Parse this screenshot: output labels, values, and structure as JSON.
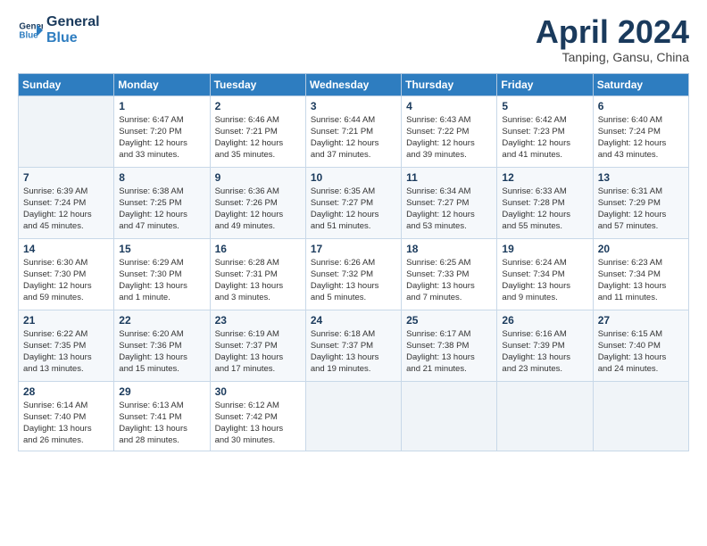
{
  "logo": {
    "line1": "General",
    "line2": "Blue"
  },
  "title": "April 2024",
  "subtitle": "Tanping, Gansu, China",
  "days_header": [
    "Sunday",
    "Monday",
    "Tuesday",
    "Wednesday",
    "Thursday",
    "Friday",
    "Saturday"
  ],
  "weeks": [
    [
      {
        "num": "",
        "info": ""
      },
      {
        "num": "1",
        "info": "Sunrise: 6:47 AM\nSunset: 7:20 PM\nDaylight: 12 hours\nand 33 minutes."
      },
      {
        "num": "2",
        "info": "Sunrise: 6:46 AM\nSunset: 7:21 PM\nDaylight: 12 hours\nand 35 minutes."
      },
      {
        "num": "3",
        "info": "Sunrise: 6:44 AM\nSunset: 7:21 PM\nDaylight: 12 hours\nand 37 minutes."
      },
      {
        "num": "4",
        "info": "Sunrise: 6:43 AM\nSunset: 7:22 PM\nDaylight: 12 hours\nand 39 minutes."
      },
      {
        "num": "5",
        "info": "Sunrise: 6:42 AM\nSunset: 7:23 PM\nDaylight: 12 hours\nand 41 minutes."
      },
      {
        "num": "6",
        "info": "Sunrise: 6:40 AM\nSunset: 7:24 PM\nDaylight: 12 hours\nand 43 minutes."
      }
    ],
    [
      {
        "num": "7",
        "info": "Sunrise: 6:39 AM\nSunset: 7:24 PM\nDaylight: 12 hours\nand 45 minutes."
      },
      {
        "num": "8",
        "info": "Sunrise: 6:38 AM\nSunset: 7:25 PM\nDaylight: 12 hours\nand 47 minutes."
      },
      {
        "num": "9",
        "info": "Sunrise: 6:36 AM\nSunset: 7:26 PM\nDaylight: 12 hours\nand 49 minutes."
      },
      {
        "num": "10",
        "info": "Sunrise: 6:35 AM\nSunset: 7:27 PM\nDaylight: 12 hours\nand 51 minutes."
      },
      {
        "num": "11",
        "info": "Sunrise: 6:34 AM\nSunset: 7:27 PM\nDaylight: 12 hours\nand 53 minutes."
      },
      {
        "num": "12",
        "info": "Sunrise: 6:33 AM\nSunset: 7:28 PM\nDaylight: 12 hours\nand 55 minutes."
      },
      {
        "num": "13",
        "info": "Sunrise: 6:31 AM\nSunset: 7:29 PM\nDaylight: 12 hours\nand 57 minutes."
      }
    ],
    [
      {
        "num": "14",
        "info": "Sunrise: 6:30 AM\nSunset: 7:30 PM\nDaylight: 12 hours\nand 59 minutes."
      },
      {
        "num": "15",
        "info": "Sunrise: 6:29 AM\nSunset: 7:30 PM\nDaylight: 13 hours\nand 1 minute."
      },
      {
        "num": "16",
        "info": "Sunrise: 6:28 AM\nSunset: 7:31 PM\nDaylight: 13 hours\nand 3 minutes."
      },
      {
        "num": "17",
        "info": "Sunrise: 6:26 AM\nSunset: 7:32 PM\nDaylight: 13 hours\nand 5 minutes."
      },
      {
        "num": "18",
        "info": "Sunrise: 6:25 AM\nSunset: 7:33 PM\nDaylight: 13 hours\nand 7 minutes."
      },
      {
        "num": "19",
        "info": "Sunrise: 6:24 AM\nSunset: 7:34 PM\nDaylight: 13 hours\nand 9 minutes."
      },
      {
        "num": "20",
        "info": "Sunrise: 6:23 AM\nSunset: 7:34 PM\nDaylight: 13 hours\nand 11 minutes."
      }
    ],
    [
      {
        "num": "21",
        "info": "Sunrise: 6:22 AM\nSunset: 7:35 PM\nDaylight: 13 hours\nand 13 minutes."
      },
      {
        "num": "22",
        "info": "Sunrise: 6:20 AM\nSunset: 7:36 PM\nDaylight: 13 hours\nand 15 minutes."
      },
      {
        "num": "23",
        "info": "Sunrise: 6:19 AM\nSunset: 7:37 PM\nDaylight: 13 hours\nand 17 minutes."
      },
      {
        "num": "24",
        "info": "Sunrise: 6:18 AM\nSunset: 7:37 PM\nDaylight: 13 hours\nand 19 minutes."
      },
      {
        "num": "25",
        "info": "Sunrise: 6:17 AM\nSunset: 7:38 PM\nDaylight: 13 hours\nand 21 minutes."
      },
      {
        "num": "26",
        "info": "Sunrise: 6:16 AM\nSunset: 7:39 PM\nDaylight: 13 hours\nand 23 minutes."
      },
      {
        "num": "27",
        "info": "Sunrise: 6:15 AM\nSunset: 7:40 PM\nDaylight: 13 hours\nand 24 minutes."
      }
    ],
    [
      {
        "num": "28",
        "info": "Sunrise: 6:14 AM\nSunset: 7:40 PM\nDaylight: 13 hours\nand 26 minutes."
      },
      {
        "num": "29",
        "info": "Sunrise: 6:13 AM\nSunset: 7:41 PM\nDaylight: 13 hours\nand 28 minutes."
      },
      {
        "num": "30",
        "info": "Sunrise: 6:12 AM\nSunset: 7:42 PM\nDaylight: 13 hours\nand 30 minutes."
      },
      {
        "num": "",
        "info": ""
      },
      {
        "num": "",
        "info": ""
      },
      {
        "num": "",
        "info": ""
      },
      {
        "num": "",
        "info": ""
      }
    ]
  ]
}
